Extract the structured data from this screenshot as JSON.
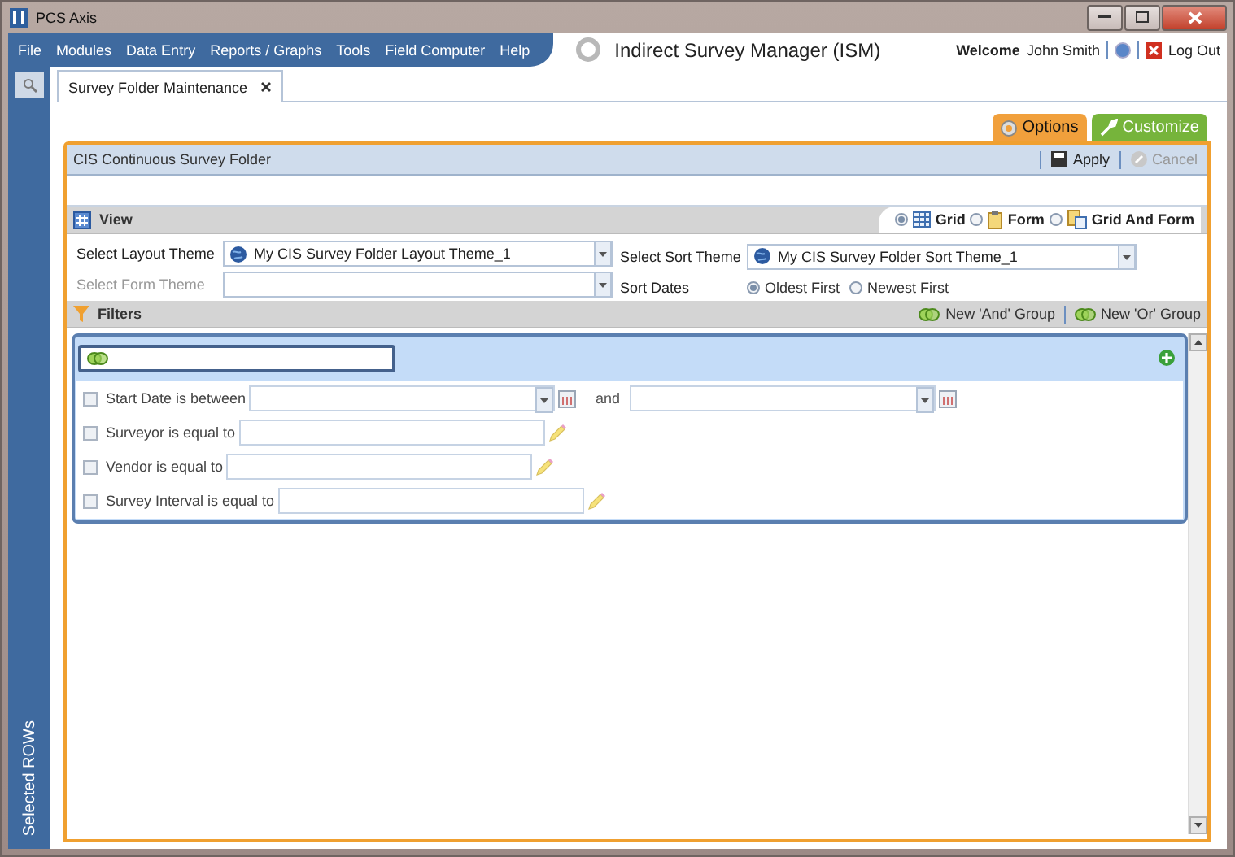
{
  "window": {
    "title": "PCS Axis"
  },
  "menu": [
    "File",
    "Modules",
    "Data Entry",
    "Reports / Graphs",
    "Tools",
    "Field Computer",
    "Help"
  ],
  "module_title": "Indirect Survey Manager (ISM)",
  "user": {
    "welcome": "Welcome",
    "name": "John Smith",
    "logout": "Log Out"
  },
  "sidebar": {
    "label": "Selected ROWs"
  },
  "tabs": [
    {
      "label": "Survey Folder Maintenance",
      "selected": true
    }
  ],
  "option_tabs": [
    {
      "label": "Options",
      "kind": "options"
    },
    {
      "label": "Customize",
      "kind": "customize"
    }
  ],
  "panel": {
    "title": "CIS Continuous Survey Folder",
    "actions": [
      {
        "label": "Apply",
        "kind": "save",
        "disabled": false
      },
      {
        "label": "Cancel",
        "kind": "cancel",
        "disabled": true
      }
    ]
  },
  "view": {
    "label": "View",
    "modes": [
      {
        "label": "Grid",
        "kind": "grid",
        "selected": true
      },
      {
        "label": "Form",
        "kind": "form",
        "selected": false
      },
      {
        "label": "Grid And Form",
        "kind": "both",
        "selected": false
      }
    ],
    "layout_theme": {
      "label": "Select Layout Theme",
      "value": "My CIS Survey Folder Layout Theme_1"
    },
    "form_theme": {
      "label": "Select Form Theme",
      "disabled": true
    },
    "sort_theme": {
      "label": "Select Sort Theme",
      "value": "My CIS Survey Folder Sort Theme_1"
    },
    "sort_dates": {
      "label": "Sort Dates",
      "options": [
        {
          "label": "Oldest First",
          "selected": true
        },
        {
          "label": "Newest First",
          "selected": false
        }
      ]
    }
  },
  "filters": {
    "label": "Filters",
    "actions": [
      "New 'And' Group",
      "New 'Or' Group"
    ],
    "conditions": [
      {
        "kind": "date_range",
        "label": "Start Date is between",
        "connector": "and",
        "checked": false
      },
      {
        "kind": "text",
        "label": "Surveyor is equal to",
        "checked": false
      },
      {
        "kind": "text",
        "label": "Vendor is equal to",
        "checked": false
      },
      {
        "kind": "text",
        "label": "Survey Interval is equal to",
        "checked": false
      }
    ]
  }
}
